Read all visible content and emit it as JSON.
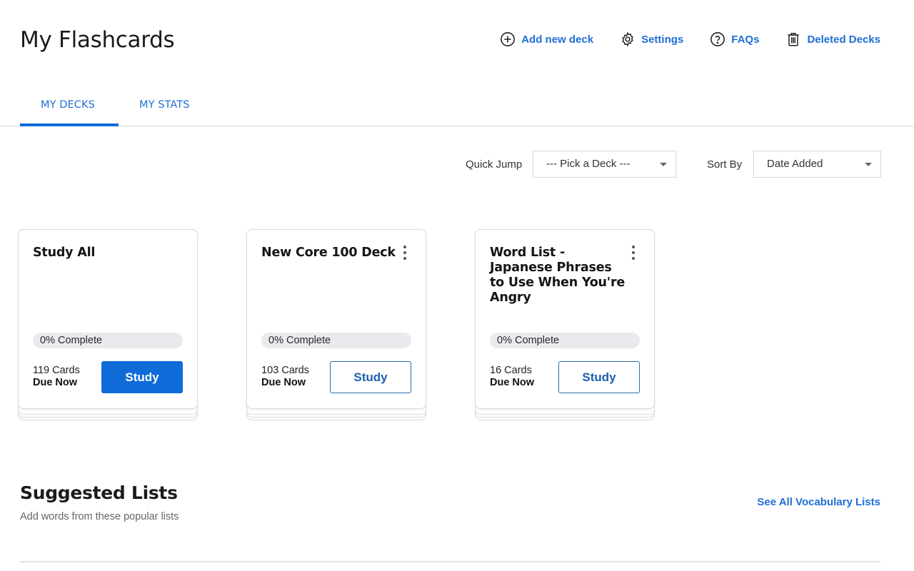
{
  "header": {
    "title": "My Flashcards",
    "actions": [
      {
        "label": "Add new deck",
        "icon": "plus-circle-icon"
      },
      {
        "label": "Settings",
        "icon": "gear-icon"
      },
      {
        "label": "FAQs",
        "icon": "question-circle-icon"
      },
      {
        "label": "Deleted Decks",
        "icon": "trash-icon"
      }
    ]
  },
  "tabs": [
    {
      "label": "MY DECKS",
      "active": true
    },
    {
      "label": "MY STATS",
      "active": false
    }
  ],
  "filters": {
    "quick_jump_label": "Quick Jump",
    "quick_jump_value": "--- Pick a Deck ---",
    "sort_by_label": "Sort By",
    "sort_by_value": "Date Added"
  },
  "decks": [
    {
      "title": "Study All",
      "has_menu": false,
      "progress_label": "0% Complete",
      "progress_percent": 0,
      "cards": "119 Cards",
      "due": "Due Now",
      "study_label": "Study",
      "primary": true
    },
    {
      "title": "New Core 100 Deck",
      "has_menu": true,
      "progress_label": "0% Complete",
      "progress_percent": 0,
      "cards": "103 Cards",
      "due": "Due Now",
      "study_label": "Study",
      "primary": false
    },
    {
      "title": "Word List - Japanese Phrases to Use When You're Angry",
      "has_menu": true,
      "progress_label": "0% Complete",
      "progress_percent": 0,
      "cards": "16 Cards",
      "due": "Due Now",
      "study_label": "Study",
      "primary": false
    }
  ],
  "suggested": {
    "title": "Suggested Lists",
    "subtitle": "Add words from these popular lists",
    "see_all_label": "See All Vocabulary Lists"
  },
  "colors": {
    "accent": "#0e6bd8",
    "link": "#1f6ed4",
    "progress_track": "#e9e9ee"
  }
}
